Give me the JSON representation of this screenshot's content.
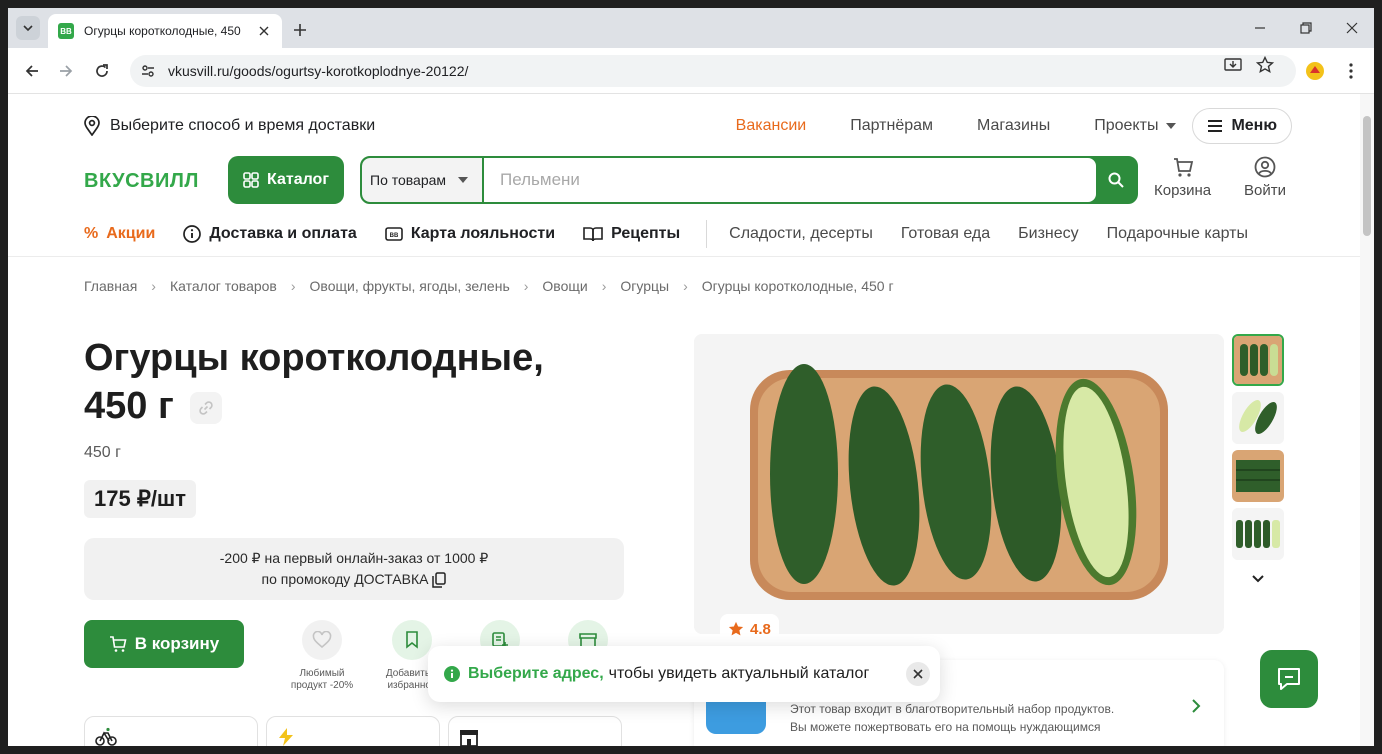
{
  "browser": {
    "tab_title": "Огурцы коротколодные, 450",
    "favicon_text": "ВВ",
    "url": "vkusvill.ru/goods/ogurtsy-korotkoplodnye-20122/"
  },
  "topline": {
    "delivery": "Выберите способ и время доставки",
    "links": [
      "Вакансии",
      "Партнёрам",
      "Магазины",
      "Проекты"
    ],
    "menu": "Меню"
  },
  "header": {
    "logo": "ВКУСВИЛЛ",
    "catalog": "Каталог",
    "search_scope": "По товарам",
    "search_placeholder": "Пельмени",
    "cart": "Корзина",
    "login": "Войти"
  },
  "nav": {
    "promos": "Акции",
    "delivery": "Доставка и оплата",
    "loyalty": "Карта лояльности",
    "recipes": "Рецепты",
    "categories": [
      "Сладости, десерты",
      "Готовая еда",
      "Бизнесу",
      "Подарочные карты"
    ]
  },
  "breadcrumbs": [
    "Главная",
    "Каталог товаров",
    "Овощи, фрукты, ягоды, зелень",
    "Овощи",
    "Огурцы",
    "Огурцы коротколодные, 450 г"
  ],
  "product": {
    "title_line1": "Огурцы коротколодные,",
    "title_line2": "450 г",
    "weight": "450 г",
    "price": "175 ₽/шт",
    "promo_line1": "-200 ₽ на первый онлайн-заказ от 1000 ₽",
    "promo_line2": "по промокоду",
    "promo_code": "ДОСТАВКА",
    "cart_button": "В корзину",
    "fav_label": "Любимый продукт -20%",
    "add_label": "Добавить в избранное",
    "rating": "4.8"
  },
  "charity": {
    "line1": "Этот товар входит в благотворительный набор продуктов.",
    "line2": "Вы можете пожертвовать его на помощь нуждающимся"
  },
  "toast": {
    "highlight": "Выберите адрес,",
    "text": "чтобы увидеть актуальный каталог"
  },
  "colors": {
    "brand_green": "#2d8c3c",
    "accent_orange": "#e86a1c"
  }
}
